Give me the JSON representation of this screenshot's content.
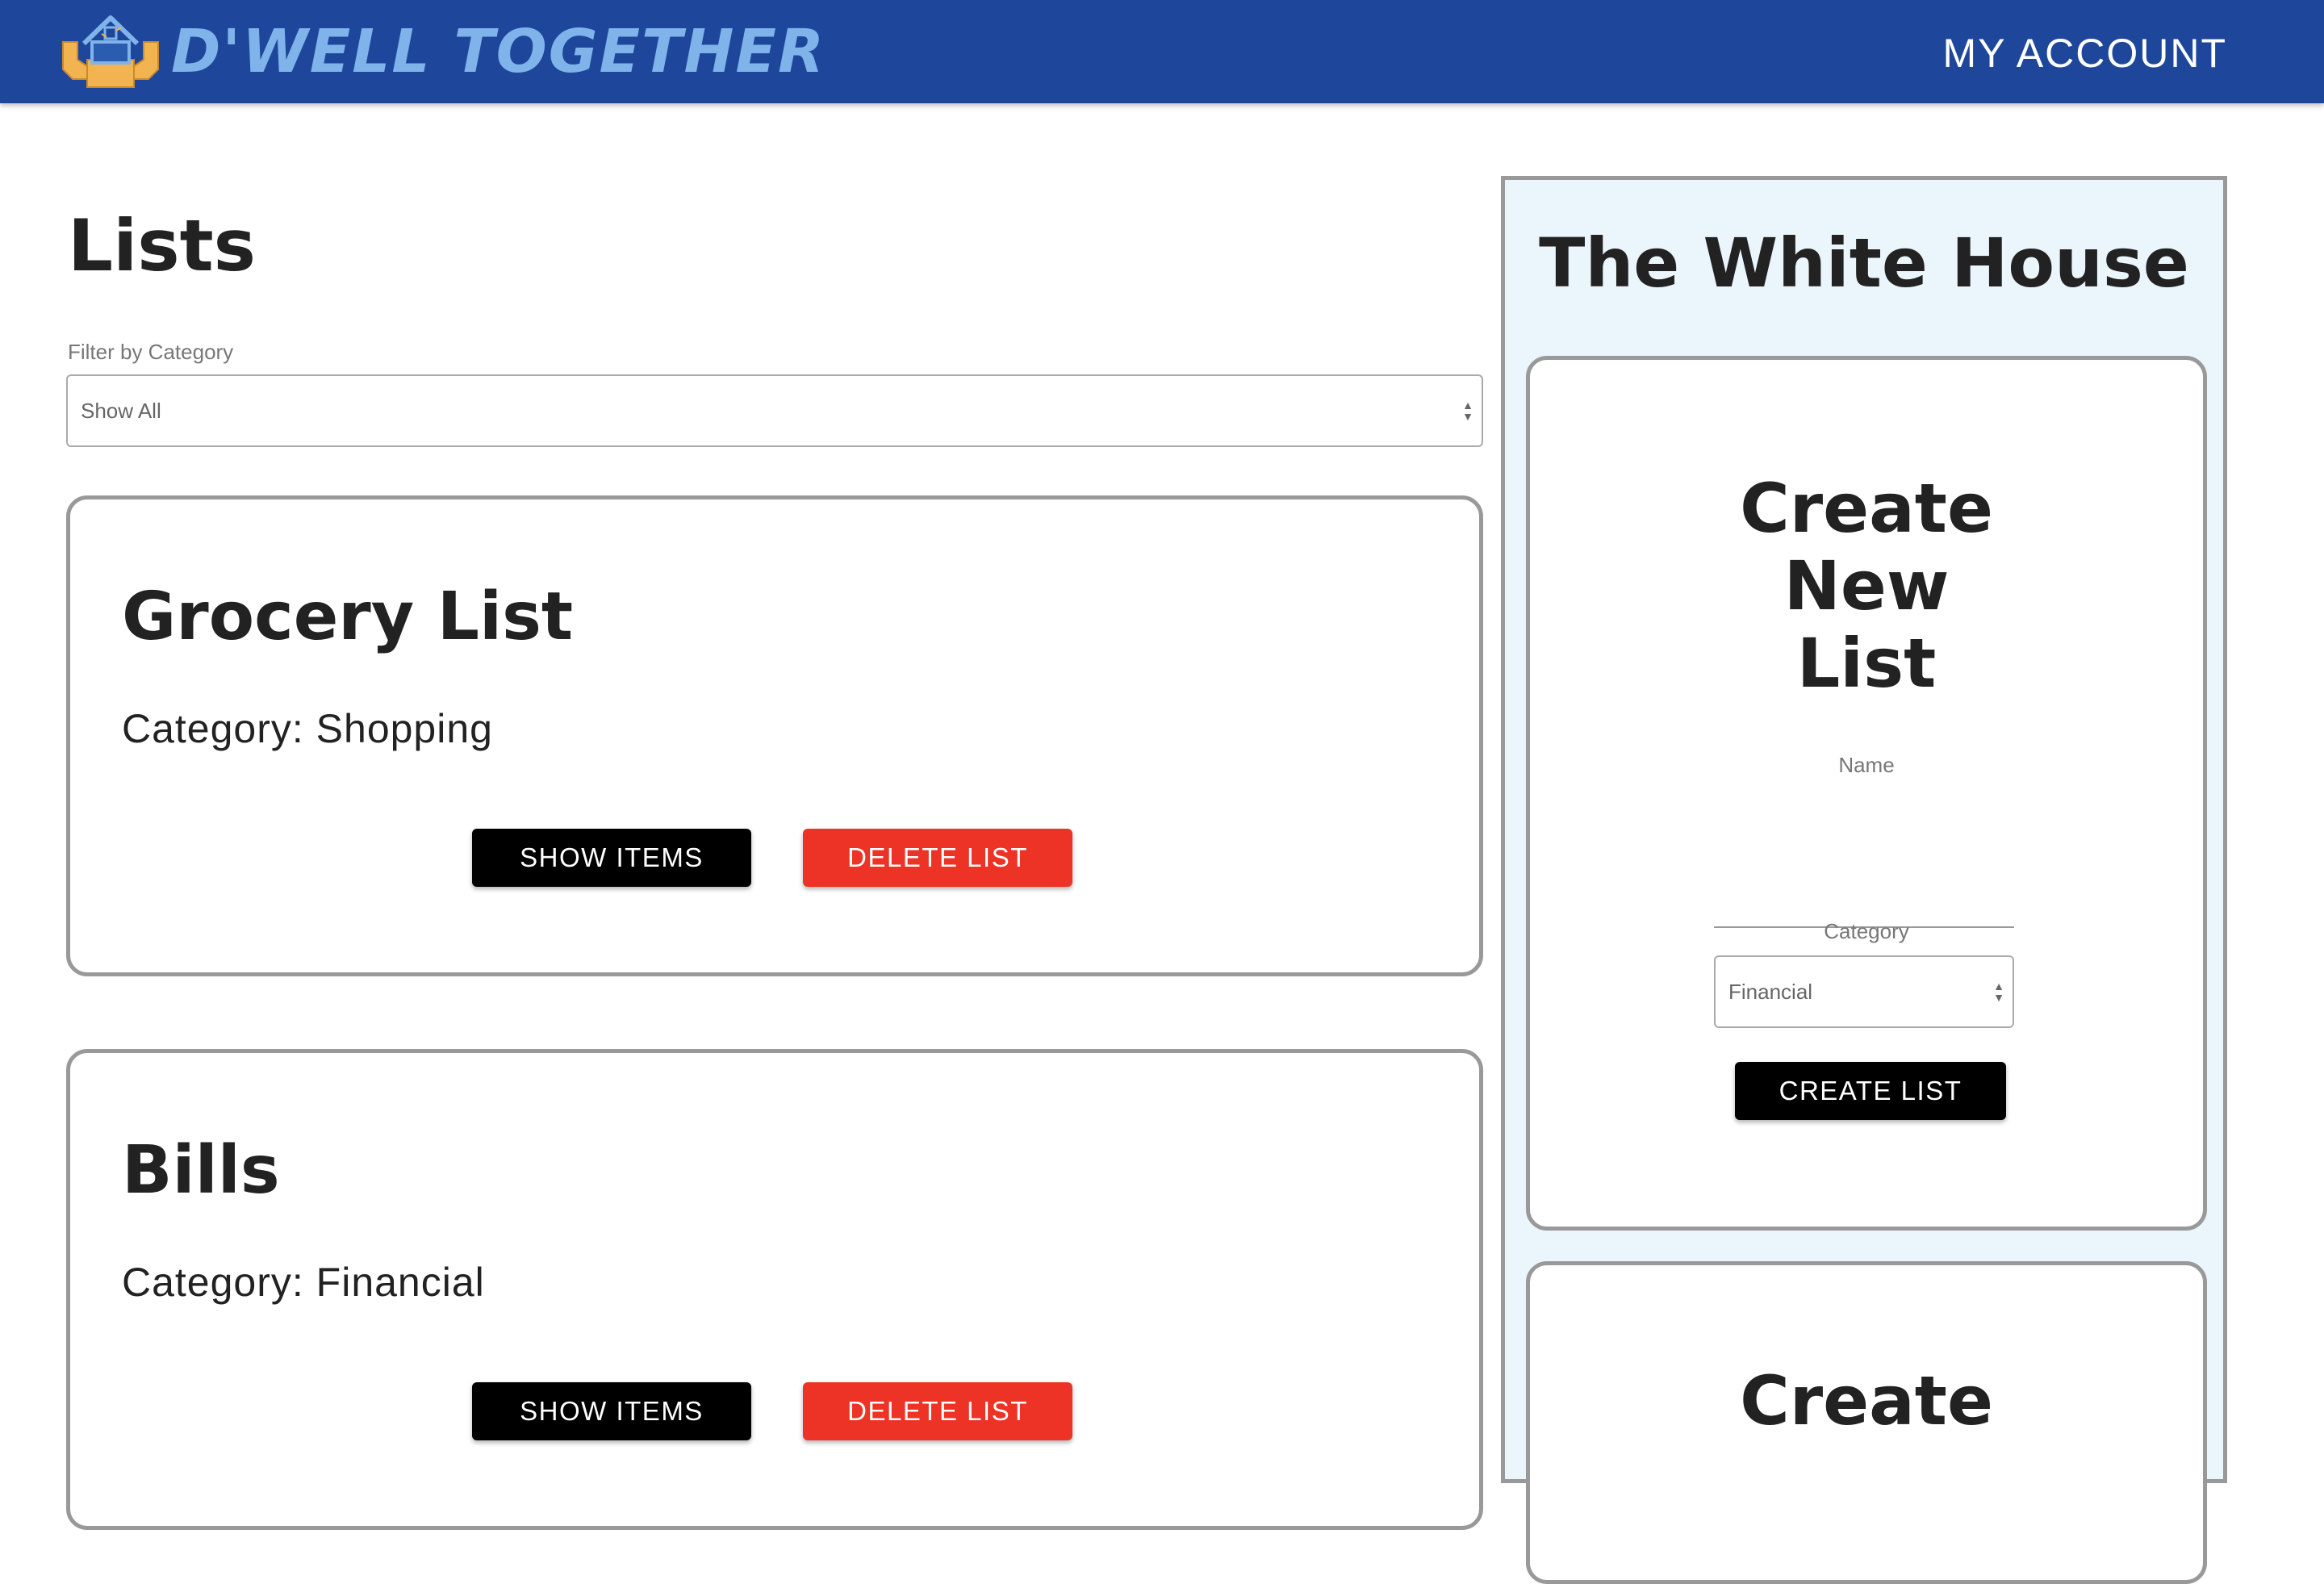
{
  "header": {
    "brand": "D'WELL TOGETHER",
    "logo_icon": "house-hands-icon",
    "account_link": "MY ACCOUNT",
    "background_color": "#1e479b",
    "brand_color": "#7fb3ea"
  },
  "main": {
    "title": "Lists",
    "filter": {
      "label": "Filter by Category",
      "selected": "Show All"
    },
    "lists": [
      {
        "title": "Grocery List",
        "category": "Category: Shopping",
        "show_label": "SHOW ITEMS",
        "delete_label": "DELETE LIST"
      },
      {
        "title": "Bills",
        "category": "Category: Financial",
        "show_label": "SHOW ITEMS",
        "delete_label": "DELETE LIST"
      }
    ]
  },
  "sidebar": {
    "house_name": "The White House",
    "create_list": {
      "title_lines": [
        "Create",
        "New",
        "List"
      ],
      "name_label": "Name",
      "name_value": "",
      "category_label": "Category",
      "category_selected": "Financial",
      "submit_label": "CREATE LIST"
    },
    "second_card": {
      "title": "Create"
    }
  },
  "colors": {
    "delete_button": "#ec3325",
    "primary_button": "#000000",
    "sidebar_background": "#eaf5fc",
    "card_border": "#999999"
  }
}
